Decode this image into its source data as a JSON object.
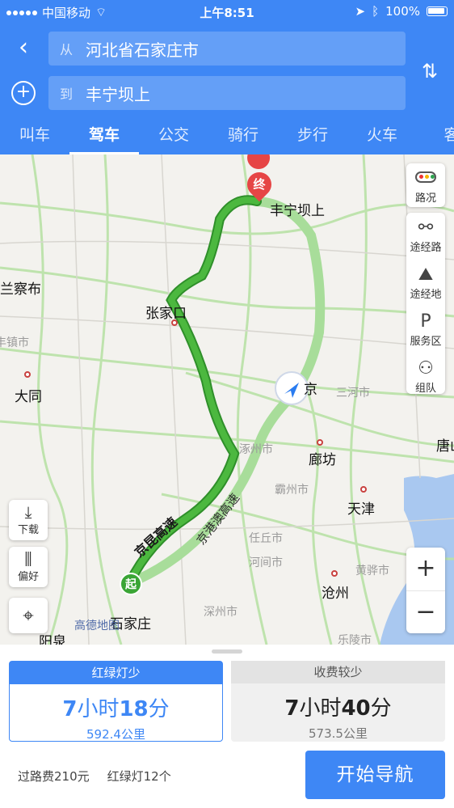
{
  "status_bar": {
    "carrier": "中国移动",
    "time": "上午8:51",
    "battery": "100%"
  },
  "route": {
    "from_prefix": "从",
    "from_value": "河北省石家庄市",
    "to_prefix": "到",
    "to_value": "丰宁坝上"
  },
  "modes": [
    {
      "label": "叫车"
    },
    {
      "label": "驾车"
    },
    {
      "label": "公交"
    },
    {
      "label": "骑行"
    },
    {
      "label": "步行"
    },
    {
      "label": "火车"
    },
    {
      "label": "客"
    }
  ],
  "active_mode": "驾车",
  "map": {
    "labels": {
      "destination": "丰宁坝上",
      "zhangjiakou": "张家口",
      "datong": "大同",
      "ulanqab": "兰察布",
      "zhenshi": "丰镇市",
      "beijing": "京",
      "sanhe": "三河市",
      "zhuozhou": "涿州市",
      "langfang": "廊坊",
      "tangshan": "唐山",
      "bazhou": "霸州市",
      "tianjin": "天津",
      "renqiu": "任丘市",
      "hejian": "河间市",
      "huanghua": "黄骅市",
      "cangzhou": "沧州",
      "shenzhou": "深州市",
      "shijiazhuang": "石家庄",
      "yangquan": "阳泉",
      "leling": "乐陵市",
      "expressway1": "京昆高速",
      "expressway2": "京港澳高速",
      "logo": "高德地图"
    },
    "start_marker": "起",
    "end_marker": "终",
    "side_panel": [
      {
        "label": "路况",
        "icon": "traffic-light-icon"
      },
      {
        "label": "途经路",
        "icon": "route-via-icon"
      },
      {
        "label": "途经地",
        "icon": "map-pin-icon"
      },
      {
        "label": "服务区",
        "icon": "service-area-icon"
      },
      {
        "label": "组队",
        "icon": "team-icon"
      }
    ],
    "download_label": "下载",
    "preference_label": "偏好",
    "zoom_in": "+",
    "zoom_out": "−"
  },
  "routes": [
    {
      "tag": "红绿灯少",
      "hours": "7",
      "hours_unit": "小时",
      "minutes": "18",
      "minutes_unit": "分",
      "distance": "592.4公里",
      "selected": true
    },
    {
      "tag": "收费较少",
      "hours": "7",
      "hours_unit": "小时",
      "minutes": "40",
      "minutes_unit": "分",
      "distance": "573.5公里",
      "selected": false
    }
  ],
  "trip": {
    "toll": "过路费210元",
    "lights": "红绿灯12个"
  },
  "start_button": "开始导航",
  "colors": {
    "accent": "#3e87f5",
    "route_selected": "#3aa535",
    "route_alt": "#a8dd9a"
  }
}
